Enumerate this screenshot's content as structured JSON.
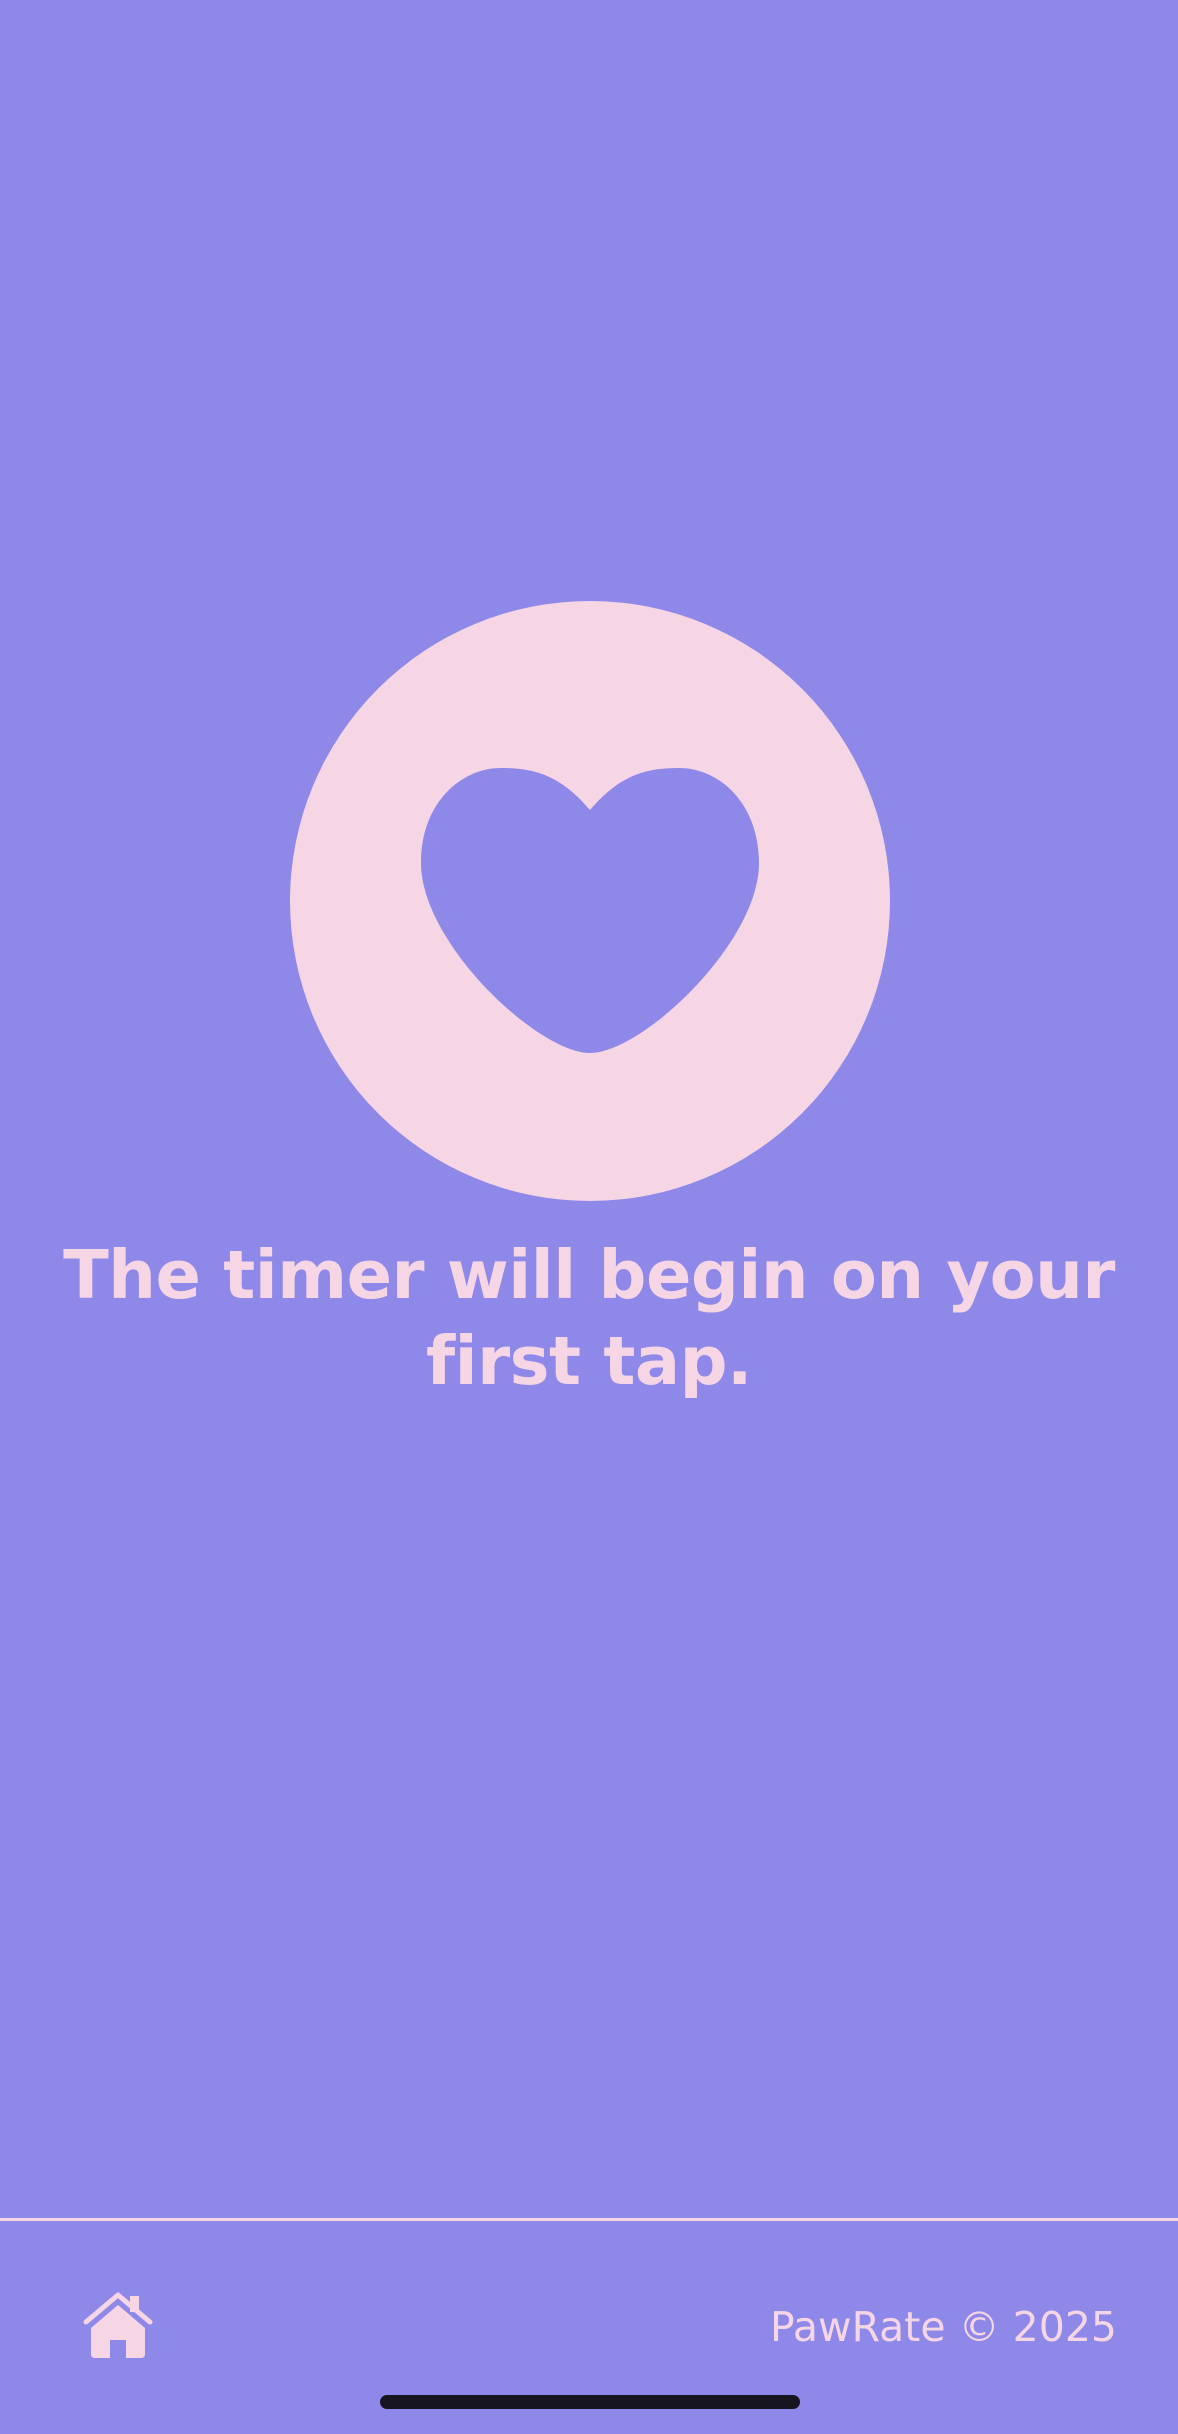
{
  "main": {
    "tap_button_icon": "heart-icon",
    "prompt": "The timer will begin on your first tap."
  },
  "footer": {
    "home_icon": "house-icon",
    "copyright": "PawRate © 2025"
  },
  "colors": {
    "background": "#8E88E9",
    "accent": "#F6D5E4",
    "home_indicator": "#17151F"
  }
}
